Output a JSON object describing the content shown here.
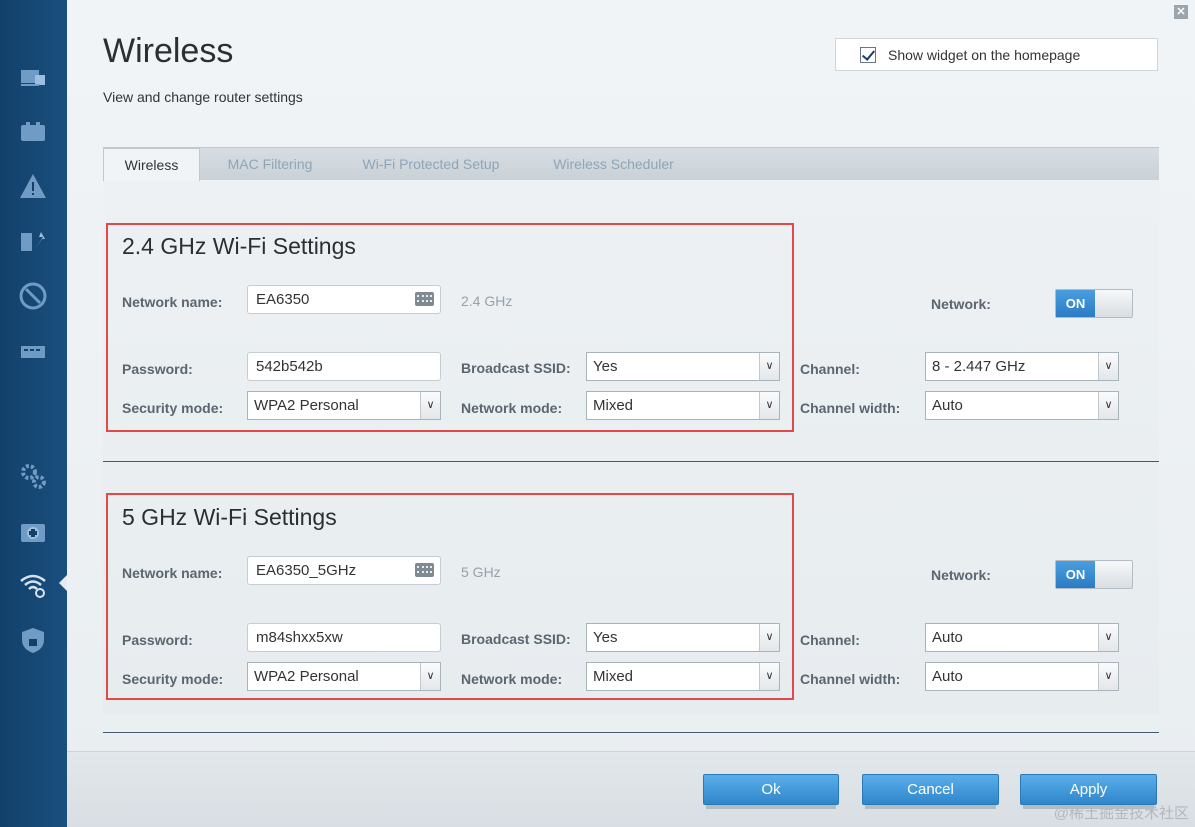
{
  "header": {
    "title": "Wireless",
    "subtitle": "View and change router settings",
    "widget_label": "Show widget on the homepage",
    "widget_checked": true
  },
  "tabs": [
    {
      "label": "Wireless",
      "active": true
    },
    {
      "label": "MAC Filtering",
      "active": false
    },
    {
      "label": "Wi-Fi Protected Setup",
      "active": false
    },
    {
      "label": "Wireless Scheduler",
      "active": false
    }
  ],
  "labels": {
    "network_name": "Network name:",
    "password": "Password:",
    "security_mode": "Security mode:",
    "broadcast_ssid": "Broadcast SSID:",
    "network_mode": "Network mode:",
    "network": "Network:",
    "channel": "Channel:",
    "channel_width": "Channel width:"
  },
  "band24": {
    "title": "2.4 GHz Wi-Fi Settings",
    "network_name": "EA6350",
    "band_hint": "2.4 GHz",
    "password": "542b542b",
    "security_mode": "WPA2 Personal",
    "broadcast_ssid": "Yes",
    "network_mode": "Mixed",
    "network_toggle": "ON",
    "channel": "8 - 2.447 GHz",
    "channel_width": "Auto"
  },
  "band5": {
    "title": "5 GHz Wi-Fi Settings",
    "network_name": "EA6350_5GHz",
    "band_hint": "5 GHz",
    "password": "m84shxx5xw",
    "security_mode": "WPA2 Personal",
    "broadcast_ssid": "Yes",
    "network_mode": "Mixed",
    "network_toggle": "ON",
    "channel": "Auto",
    "channel_width": "Auto"
  },
  "footer": {
    "ok": "Ok",
    "cancel": "Cancel",
    "apply": "Apply"
  },
  "watermark": "@稀土掘金技术社区",
  "colors": {
    "sidebar": "#12406a",
    "highlight_box": "#e14a48",
    "button": "#3a93d6",
    "toggle_on": "#2b7cc3"
  },
  "sidebar_icons": [
    "device-list-icon",
    "external-storage-icon",
    "troubleshooting-icon",
    "media-prioritization-icon",
    "parental-controls-icon",
    "usb-storage-icon",
    "connectivity-icon",
    "troubleshoot-kit-icon",
    "wireless-icon",
    "security-icon"
  ]
}
